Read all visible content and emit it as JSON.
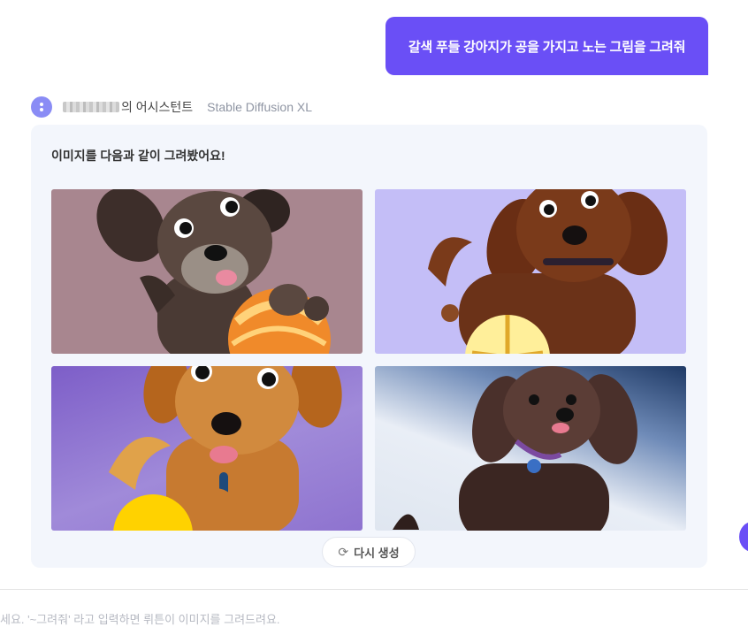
{
  "user_message": "갈색 푸들 강아지가 공을 가지고 노는 그림을 그려줘",
  "assistant": {
    "name_suffix": "의 어시스턴트",
    "model": "Stable Diffusion XL"
  },
  "response": {
    "text": "이미지를 다음과 같이 그려봤어요!",
    "images": [
      {
        "name": "dark brown puppy with orange ball",
        "bg": "#a8868f"
      },
      {
        "name": "brown poodle with yellow ball",
        "bg": "#c4bef7"
      },
      {
        "name": "golden puppy with yellow ball",
        "bg": "#8e73cf"
      },
      {
        "name": "watercolor brown poodle",
        "bg": "#e9eef6"
      }
    ],
    "regenerate_label": "다시 생성",
    "regenerate_icon": "refresh-icon"
  },
  "input_hint": "세요. '~그려줘' 라고 입력하면 뤼튼이 이미지를 그려드려요.",
  "colors": {
    "accent": "#6a4ff6",
    "card_bg": "#f3f6fc",
    "avatar": "#8a8cf5"
  }
}
